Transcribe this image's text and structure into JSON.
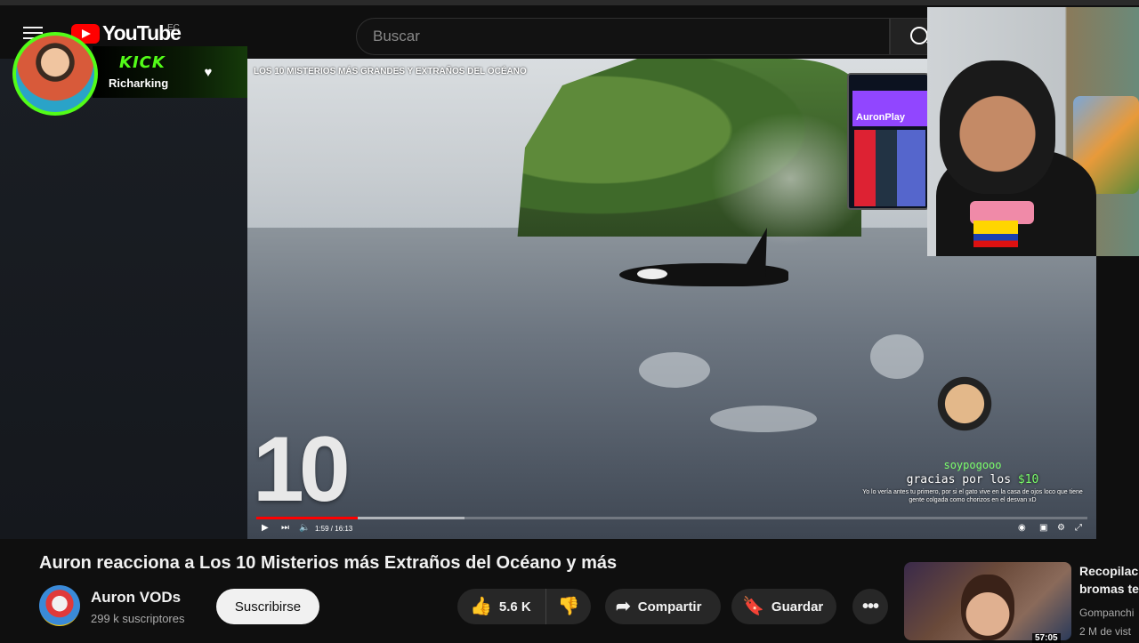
{
  "masthead": {
    "logo_text": "YouTube",
    "country_code": "EC",
    "search_placeholder": "Buscar"
  },
  "kick_overlay": {
    "logo": "KICK",
    "streamer": "Richarking"
  },
  "video": {
    "overlay_title": "LOS 10 MISTERIOS MÁS GRANDES Y EXTRAÑOS DEL OCÉANO",
    "big_number": "10",
    "time": "1:59 / 16:13",
    "progress": 0.122,
    "buffered": 0.25,
    "twitch_name": "AuronPlay"
  },
  "donation": {
    "user": "soypogooo",
    "message_prefix": "gracias por los",
    "amount": "$10",
    "text": "Yo lo vería antes tu primero, por si el gato vive en la casa de ojos loco que tiene gente colgada como chorizos en el desvan xD"
  },
  "info": {
    "title": "Auron reacciona a Los 10 Misterios más Extraños del Océano y más",
    "channel": "Auron VODs",
    "subscribers": "299 k suscriptores",
    "subscribe_label": "Suscribirse",
    "likes": "5.6 K",
    "share_label": "Compartir",
    "save_label": "Guardar"
  },
  "recommended": {
    "title_line1": "Recopilac",
    "title_line2": "bromas te",
    "channel": "Gompanchi",
    "views": "2 M de vist",
    "duration": "57:05"
  },
  "colors": {
    "youtube_red": "#ff0000",
    "kick_green": "#53fc18",
    "twitch_purple": "#9146ff",
    "donation_green": "#7bff6a"
  }
}
